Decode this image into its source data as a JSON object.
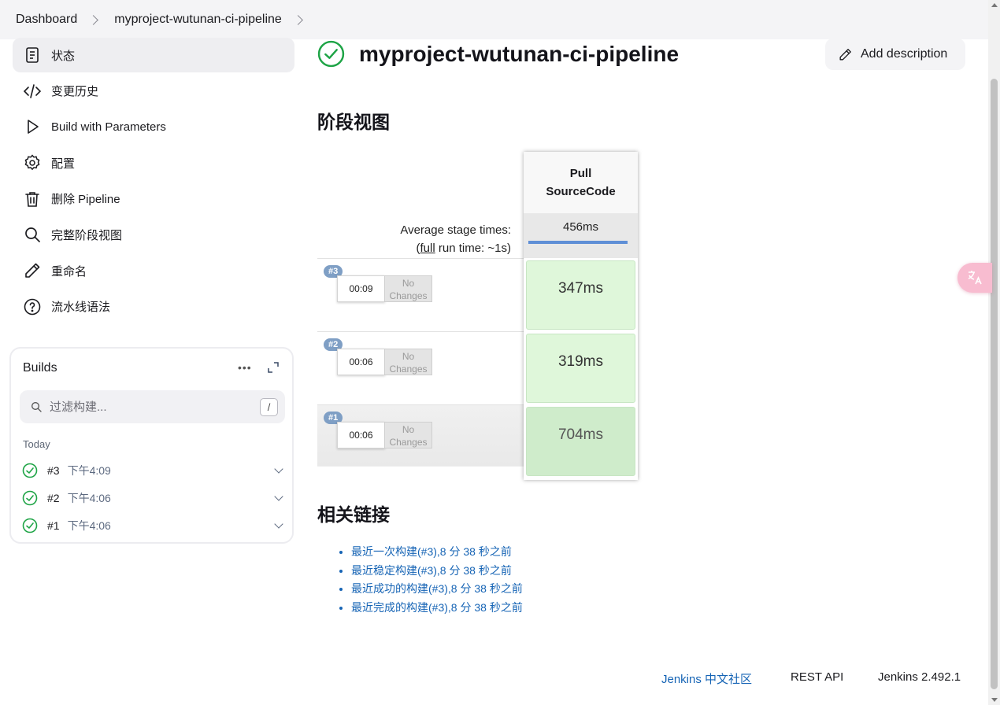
{
  "breadcrumb": {
    "items": [
      "Dashboard",
      "myproject-wutunan-ci-pipeline"
    ]
  },
  "sidebar": {
    "items": [
      {
        "label": "状态",
        "icon": "document-icon",
        "active": true
      },
      {
        "label": "变更历史",
        "icon": "code-icon"
      },
      {
        "label": "Build with Parameters",
        "icon": "play-icon"
      },
      {
        "label": "配置",
        "icon": "gear-icon"
      },
      {
        "label": "删除 Pipeline",
        "icon": "trash-icon"
      },
      {
        "label": "完整阶段视图",
        "icon": "search-icon"
      },
      {
        "label": "重命名",
        "icon": "pencil-icon"
      },
      {
        "label": "流水线语法",
        "icon": "help-icon"
      }
    ]
  },
  "builds": {
    "title": "Builds",
    "more": "•••",
    "filter_placeholder": "过滤构建...",
    "shortcut": "/",
    "group_label": "Today",
    "items": [
      {
        "number": "#3",
        "time": "下午4:09",
        "status": "success"
      },
      {
        "number": "#2",
        "time": "下午4:06",
        "status": "success"
      },
      {
        "number": "#1",
        "time": "下午4:06",
        "status": "success"
      }
    ]
  },
  "header": {
    "title": "myproject-wutunan-ci-pipeline",
    "status": "success",
    "add_description": "Add description"
  },
  "stage_view": {
    "heading": "阶段视图",
    "avg_label_line1": "Average stage times:",
    "avg_label_full": "full",
    "avg_label_rest": " run time: ~1s)",
    "avg_label_open": "(",
    "stage_name": "Pull SourceCode",
    "stage_avg": "456ms",
    "runs": [
      {
        "badge": "#3",
        "duration": "00:09",
        "changes": "No Changes",
        "stage_time": "347ms"
      },
      {
        "badge": "#2",
        "duration": "00:06",
        "changes": "No Changes",
        "stage_time": "319ms"
      },
      {
        "badge": "#1",
        "duration": "00:06",
        "changes": "No Changes",
        "stage_time": "704ms"
      }
    ]
  },
  "related": {
    "heading": "相关链接",
    "links": [
      "最近一次构建(#3),8 分 38 秒之前",
      "最近稳定构建(#3),8 分 38 秒之前",
      "最近成功的构建(#3),8 分 38 秒之前",
      "最近完成的构建(#3),8 分 38 秒之前"
    ]
  },
  "footer": {
    "community": "Jenkins 中文社区",
    "rest_api": "REST API",
    "version": "Jenkins 2.492.1"
  },
  "colors": {
    "success": "#1ea446",
    "link": "#1664b5",
    "stage_bar": "#5f8fd6"
  },
  "translate_icon": "translate-icon"
}
